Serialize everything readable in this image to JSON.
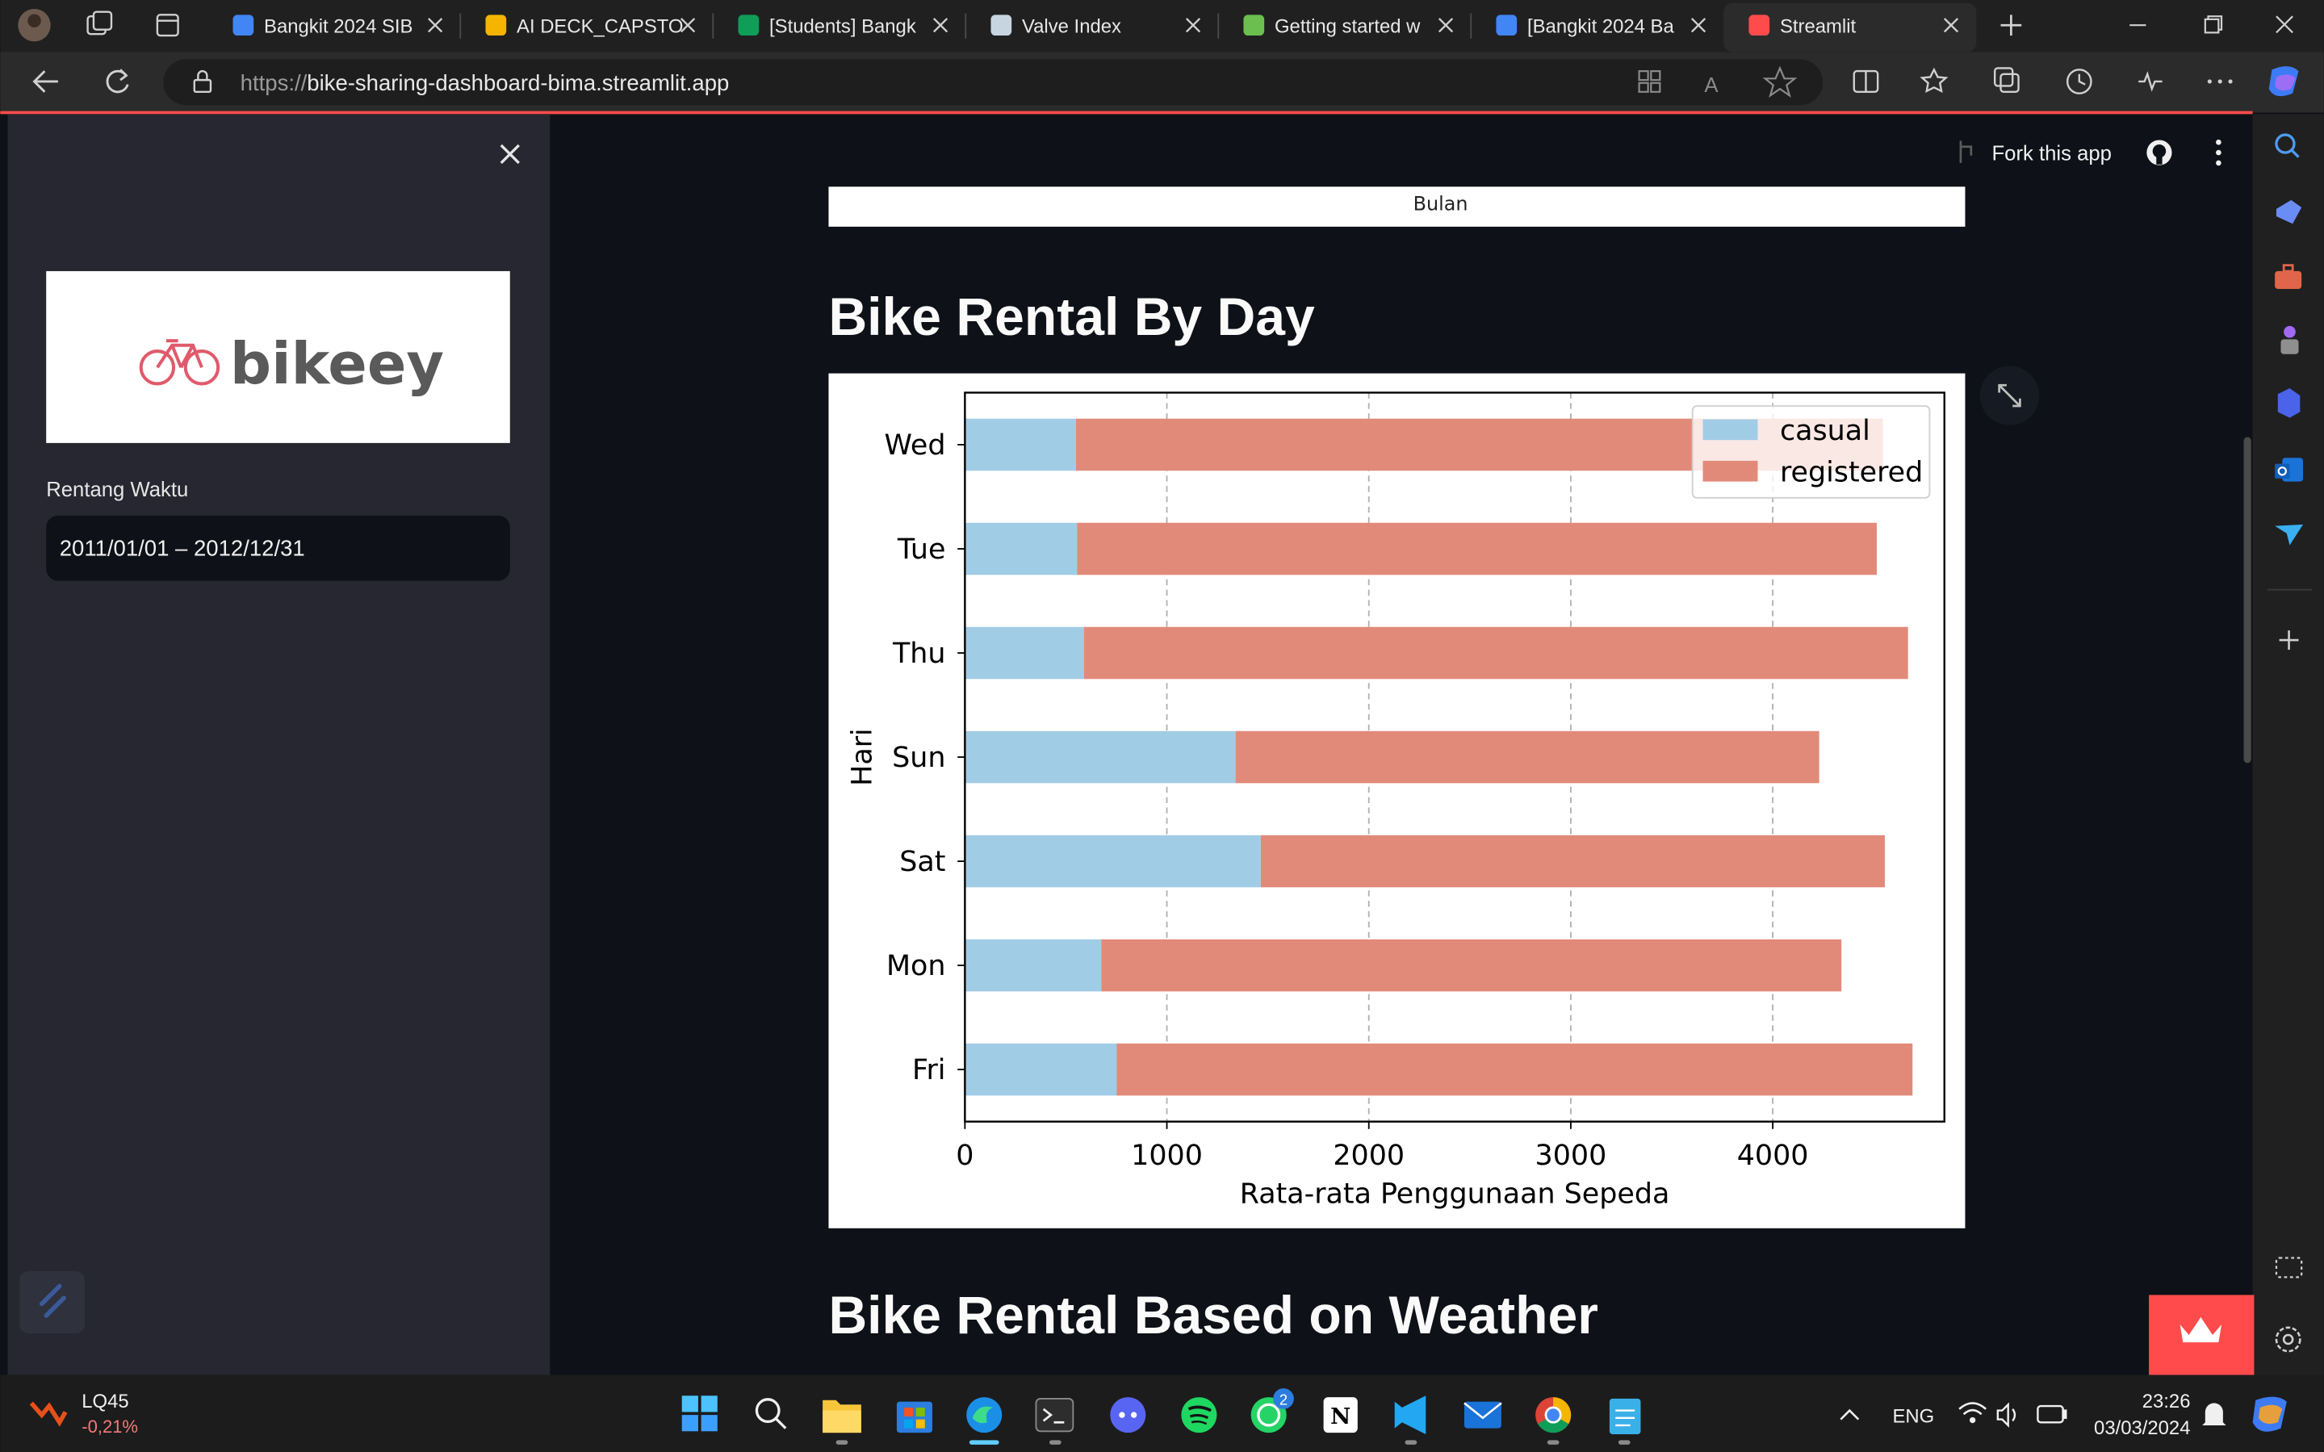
{
  "browser": {
    "tabs": [
      {
        "title": "Bangkit 2024 SIB",
        "icon": "google-drive-icon",
        "color": "#4285f4"
      },
      {
        "title": "AI DECK_CAPSTO",
        "icon": "slides-icon",
        "color": "#f4b400"
      },
      {
        "title": "[Students] Bangk",
        "icon": "sheets-icon",
        "color": "#0f9d58"
      },
      {
        "title": "Valve Index",
        "icon": "steam-icon",
        "color": "#c7d5e0"
      },
      {
        "title": "Getting started w",
        "icon": "generic-site-icon",
        "color": "#6bbf4e"
      },
      {
        "title": "[Bangkit 2024 Ba",
        "icon": "docs-icon",
        "color": "#4285f4"
      },
      {
        "title": "Streamlit",
        "icon": "streamlit-icon",
        "color": "#ff4b4b"
      }
    ],
    "url_prefix": "https://",
    "url_host": "bike-sharing-dashboard-bima.streamlit.app"
  },
  "app": {
    "sidebar": {
      "logo_text": "bikeey",
      "date_label": "Rentang Waktu",
      "date_value": "2011/01/01 – 2012/12/31"
    },
    "header": {
      "fork_label": "Fork this app"
    },
    "prev_chart_xlabel": "Bulan",
    "section1_title": "Bike Rental By Day",
    "section2_title": "Bike Rental Based on Weather"
  },
  "chart_data": {
    "type": "bar",
    "orientation": "horizontal",
    "stacked": true,
    "categories": [
      "Wed",
      "Tue",
      "Thu",
      "Sun",
      "Sat",
      "Mon",
      "Fri"
    ],
    "series": [
      {
        "name": "casual",
        "color": "#a1cce6",
        "values": [
          550,
          555,
          590,
          1340,
          1465,
          675,
          752
        ]
      },
      {
        "name": "registered",
        "color": "#e28a79",
        "values": [
          3995,
          3960,
          4080,
          2890,
          3090,
          3665,
          3940
        ]
      }
    ],
    "xlabel": "Rata-rata Penggunaan Sepeda",
    "ylabel": "Hari",
    "xlim": [
      0,
      4850
    ],
    "xticks": [
      0,
      1000,
      2000,
      3000,
      4000
    ],
    "grid": "x-dashed",
    "legend": "top-right"
  },
  "taskbar": {
    "stock_name": "LQ45",
    "stock_change": "-0,21%",
    "language": "ENG",
    "time": "23:26",
    "date": "03/03/2024",
    "whatsapp_badge": "2"
  }
}
